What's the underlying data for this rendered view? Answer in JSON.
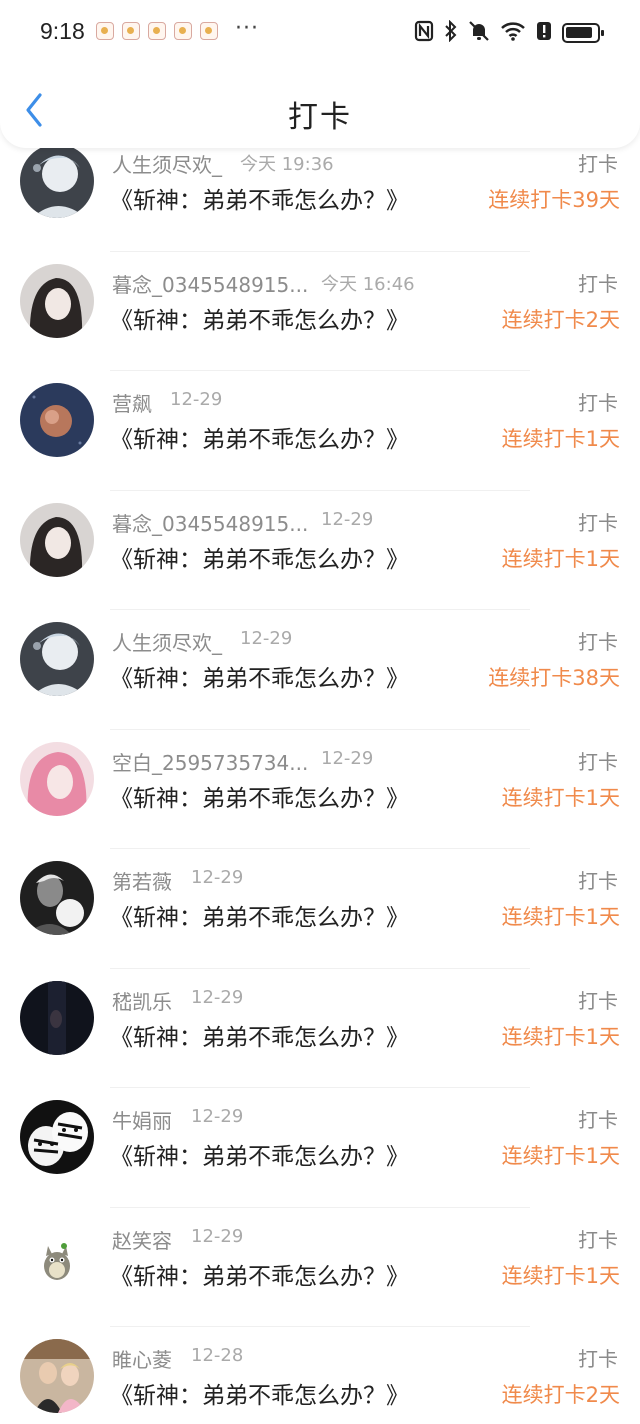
{
  "status_bar": {
    "time": "9:18",
    "more": "···"
  },
  "header": {
    "title": "打卡"
  },
  "entries": [
    {
      "name": "人生须尽欢_",
      "time": "今天 19:36",
      "action": "打卡",
      "book": "《斩神：弟弟不乖怎么办？》",
      "streak": "连续打卡39天"
    },
    {
      "name": "暮念_0345548915...",
      "time": "今天 16:46",
      "action": "打卡",
      "book": "《斩神：弟弟不乖怎么办？》",
      "streak": "连续打卡2天"
    },
    {
      "name": "营飙",
      "time": "12-29",
      "action": "打卡",
      "book": "《斩神：弟弟不乖怎么办？》",
      "streak": "连续打卡1天"
    },
    {
      "name": "暮念_0345548915...",
      "time": "12-29",
      "action": "打卡",
      "book": "《斩神：弟弟不乖怎么办？》",
      "streak": "连续打卡1天"
    },
    {
      "name": "人生须尽欢_",
      "time": "12-29",
      "action": "打卡",
      "book": "《斩神：弟弟不乖怎么办？》",
      "streak": "连续打卡38天"
    },
    {
      "name": "空白_2595735734...",
      "time": "12-29",
      "action": "打卡",
      "book": "《斩神：弟弟不乖怎么办？》",
      "streak": "连续打卡1天"
    },
    {
      "name": "第若薇",
      "time": "12-29",
      "action": "打卡",
      "book": "《斩神：弟弟不乖怎么办？》",
      "streak": "连续打卡1天"
    },
    {
      "name": "嵇凯乐",
      "time": "12-29",
      "action": "打卡",
      "book": "《斩神：弟弟不乖怎么办？》",
      "streak": "连续打卡1天"
    },
    {
      "name": "牛娟丽",
      "time": "12-29",
      "action": "打卡",
      "book": "《斩神：弟弟不乖怎么办？》",
      "streak": "连续打卡1天"
    },
    {
      "name": "赵笑容",
      "time": "12-29",
      "action": "打卡",
      "book": "《斩神：弟弟不乖怎么办？》",
      "streak": "连续打卡1天"
    },
    {
      "name": "睢心菱",
      "time": "12-28",
      "action": "打卡",
      "book": "《斩神：弟弟不乖怎么办？》",
      "streak": "连续打卡2天"
    }
  ],
  "colors": {
    "accent": "#f08a4b",
    "back": "#3d8ee8",
    "muted": "#8c8c8c"
  },
  "icons": [
    "nfc-icon",
    "bluetooth-icon",
    "mute-icon",
    "wifi-icon",
    "alert-icon",
    "battery-icon",
    "back-arrow-icon"
  ]
}
